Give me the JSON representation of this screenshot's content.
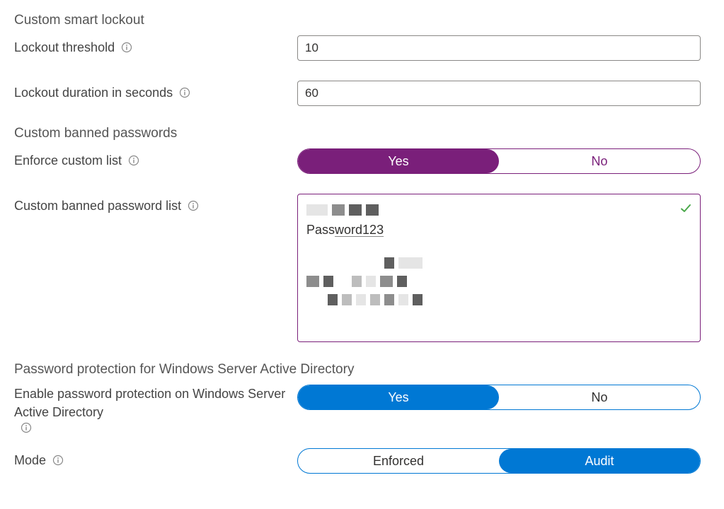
{
  "sections": {
    "smart_lockout": "Custom smart lockout",
    "banned_passwords": "Custom banned passwords",
    "password_protection": "Password protection for Windows Server Active Directory"
  },
  "fields": {
    "lockout_threshold": {
      "label": "Lockout threshold",
      "value": "10"
    },
    "lockout_duration": {
      "label": "Lockout duration in seconds",
      "value": "60"
    },
    "enforce_custom_list": {
      "label": "Enforce custom list",
      "options": {
        "yes": "Yes",
        "no": "No"
      },
      "selected": "yes"
    },
    "custom_banned_list": {
      "label": "Custom banned password list",
      "visible_entry": "Password123"
    },
    "enable_protection": {
      "label": "Enable password protection on Windows Server Active Directory",
      "options": {
        "yes": "Yes",
        "no": "No"
      },
      "selected": "yes"
    },
    "mode": {
      "label": "Mode",
      "options": {
        "enforced": "Enforced",
        "audit": "Audit"
      },
      "selected": "audit"
    }
  },
  "icons": {
    "info": "info-icon",
    "check": "check-icon"
  }
}
